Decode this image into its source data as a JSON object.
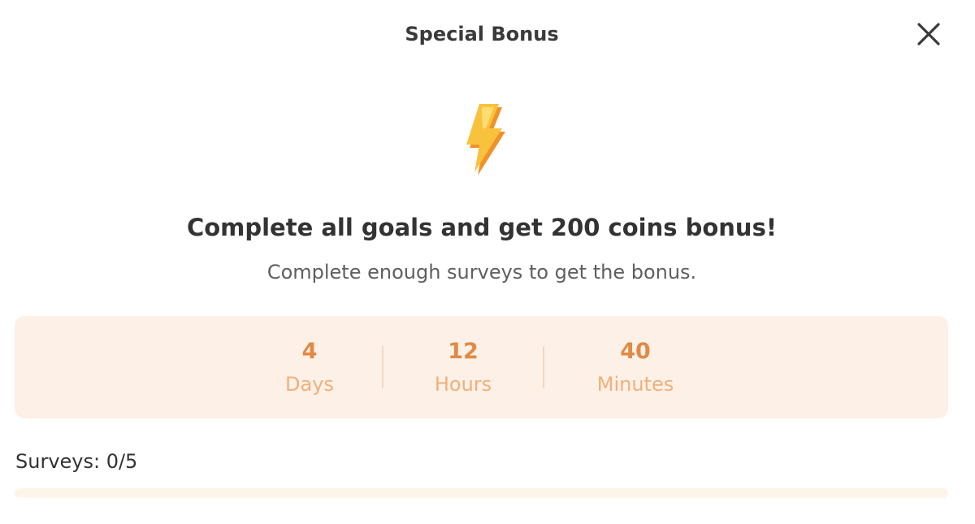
{
  "modal": {
    "title": "Special Bonus",
    "close_icon": "close-icon",
    "bolt_icon": "lightning-bolt-icon",
    "headline": "Complete all goals and get 200 coins bonus!",
    "subline": "Complete enough surveys to get the bonus."
  },
  "countdown": {
    "days": {
      "value": "4",
      "label": "Days"
    },
    "hours": {
      "value": "12",
      "label": "Hours"
    },
    "minutes": {
      "value": "40",
      "label": "Minutes"
    }
  },
  "surveys": {
    "label": "Surveys: 0/5",
    "completed": 0,
    "total": 5,
    "progress_fraction": 0
  },
  "colors": {
    "accent": "#e08a45",
    "accent_light": "#f0b07a",
    "panel_bg": "#fdf0e6",
    "track_bg": "#fdf5ea",
    "bolt_yellow": "#f9c23c",
    "bolt_orange": "#f0922a"
  }
}
